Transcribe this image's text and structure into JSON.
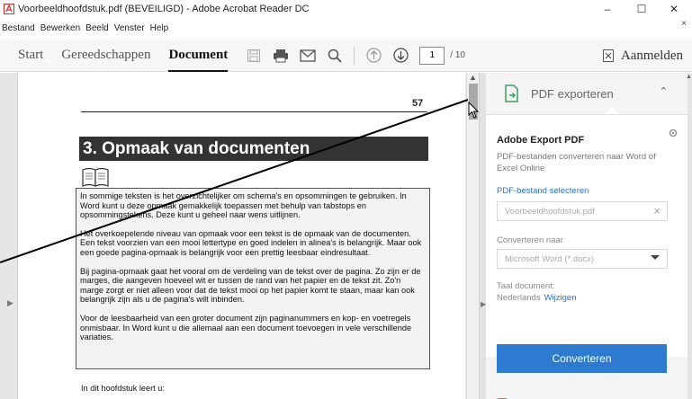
{
  "window": {
    "title": "Voorbeeldhoofdstuk.pdf (BEVEILIGD) - Adobe Acrobat Reader DC",
    "minimize": "–",
    "maximize": "☐",
    "close": "✕"
  },
  "menu": {
    "items": [
      "Bestand",
      "Bewerken",
      "Beeld",
      "Venster",
      "Help"
    ],
    "close": "×"
  },
  "toolbar": {
    "tabs": [
      "Start",
      "Gereedschappen",
      "Document"
    ],
    "active_tab": "Document",
    "page_current": "1",
    "page_total": "/ 10",
    "signin": "Aanmelden"
  },
  "document": {
    "page_number": "57",
    "heading": "3. Opmaak van documenten",
    "paragraphs": [
      "In sommige teksten is het overzichtelijker om schema's en opsommingen te gebruiken. In Word kunt u deze opmaak gemakkelijk toepassen met behulp van tabstops en opsommingstekens. Deze kunt u geheel naar wens uitlijnen.",
      "Het overkoepelende niveau van opmaak voor een tekst is de opmaak van de documenten. Een tekst voorzien van een mooi lettertype en goed indelen in alinea's is belangrijk. Maar ook een goede pagina-opmaak is belangrijk voor een prettig leesbaar eindresultaat.",
      "Bij pagina-opmaak gaat het vooral om de verdeling van de tekst over de pagina. Zo zijn er de marges, die aangeven hoeveel wit er tussen de rand van het papier en de tekst zit. Zo'n marge zorgt er niet alleen voor dat de tekst mooi op het papier komt te staan, maar kan ook belangrijk zijn als u de pagina's wilt inbinden.",
      "Voor de leesbaarheid van een groter document zijn paginanummers en kop- en voetregels onmisbaar. In Word kunt u die allemaal aan een document toevoegen in vele verschillende variaties."
    ],
    "after_text": "In dit hoofdstuk leert u:"
  },
  "panel": {
    "export_label": "PDF exporteren",
    "card_title": "Adobe Export PDF",
    "card_desc": "PDF-bestanden converteren naar Word of Excel Online",
    "select_link": "PDF-bestand selecteren",
    "file_name": "Voorbeeldhoofdstuk.pdf",
    "file_clear": "×",
    "convert_to_label": "Converteren naar",
    "convert_to_value": "Microsoft Word (*.docx)",
    "language_label": "Taal document:",
    "language_value": "Nederlands",
    "language_change": "Wijzigen",
    "convert_button": "Converteren"
  },
  "colors": {
    "accent": "#2d7bd1",
    "link": "#2d71c8",
    "heading_bg": "#333333",
    "acrobat_red": "#d7282f"
  }
}
